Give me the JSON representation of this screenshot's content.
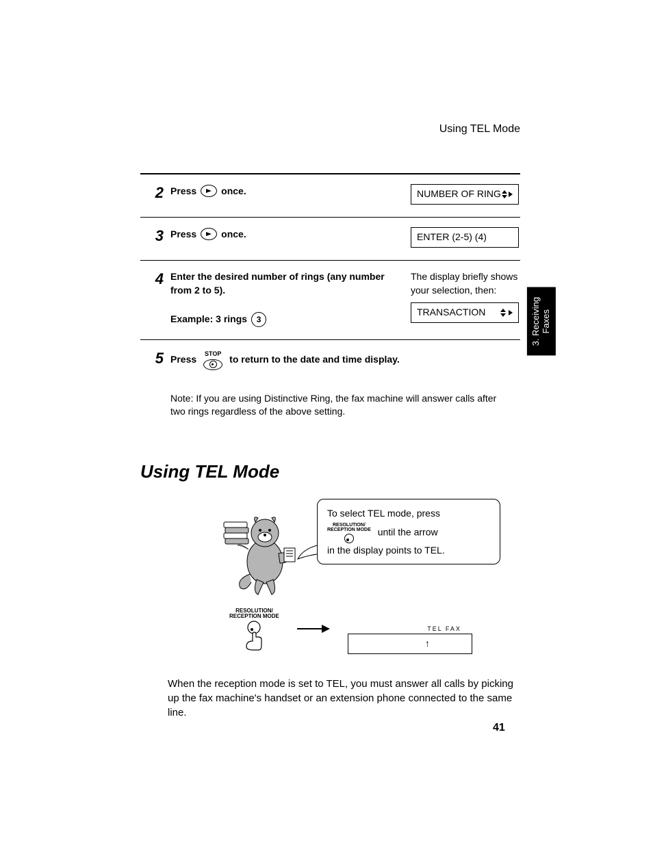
{
  "header": {
    "running_title": "Using TEL Mode"
  },
  "side_tab": "3. Receiving\nFaxes",
  "steps": {
    "s2": {
      "num": "2",
      "press": "Press",
      "suffix": "once.",
      "display": "NUMBER OF RING"
    },
    "s3": {
      "num": "3",
      "press": "Press",
      "suffix": "once.",
      "display": "ENTER (2-5) (4)"
    },
    "s4": {
      "num": "4",
      "instruction": "Enter the desired number of rings (any number from 2 to 5).",
      "example_prefix": "Example: 3 rings",
      "example_digit": "3",
      "right_note": "The display briefly shows your selection, then:",
      "display": "TRANSACTION"
    },
    "s5": {
      "num": "5",
      "press": "Press",
      "stop_label": "STOP",
      "suffix": "to return to the date and time display."
    }
  },
  "note": "Note: If you are using Distinctive Ring, the fax machine will answer calls after two rings regardless of the above setting.",
  "section_heading": "Using TEL Mode",
  "speech": {
    "line1": "To select TEL mode, press",
    "btn_top": "RESOLUTION/",
    "btn_bot": "RECEPTION MODE",
    "line2_suffix": "until the arrow",
    "line3": "in the display points to TEL."
  },
  "diagram": {
    "btn_top": "RESOLUTION/",
    "btn_bot": "RECEPTION MODE",
    "lcd_labels": "TEL  FAX"
  },
  "body_para": "When the reception mode is set to TEL, you must answer all calls by picking up the fax machine's handset or an extension phone connected to the same line.",
  "page_number": "41"
}
